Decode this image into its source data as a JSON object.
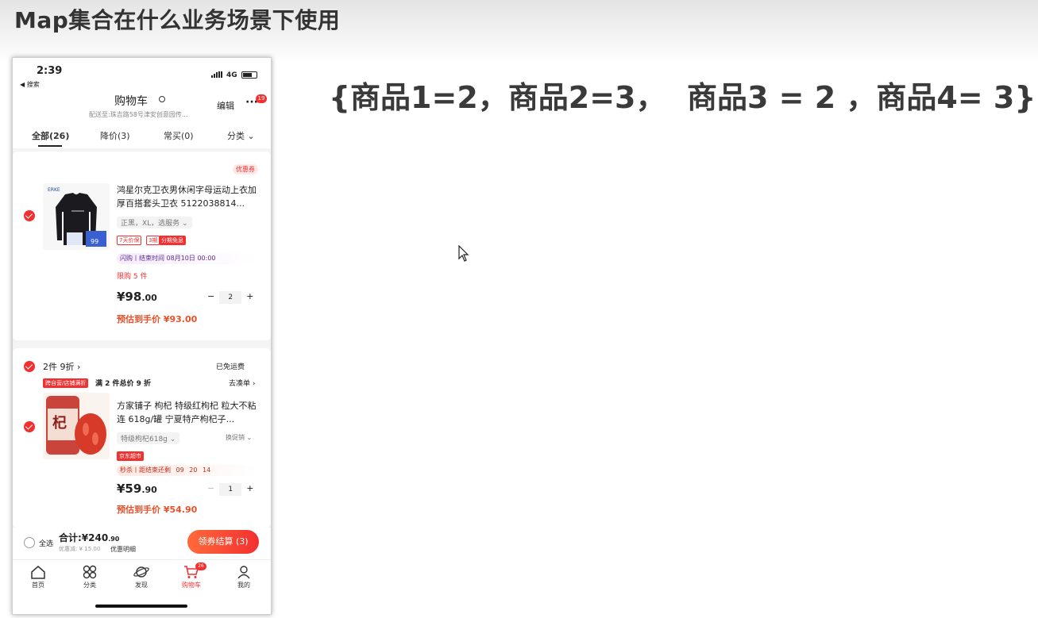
{
  "slide": {
    "title": "Map集合在什么业务场景下使用",
    "formula": "{商品1=2，商品2=3，  商品3 = 2 ，商品4= 3}"
  },
  "phone": {
    "status": {
      "time": "2:39",
      "back": "◀ 搜索",
      "network": "4G"
    },
    "nav": {
      "title": "购物车",
      "address": "配送至:珠吉路58号津安创意园传...",
      "edit": "编辑",
      "more": "···",
      "badge": "19"
    },
    "tabs": [
      "全部(26)",
      "降价(3)",
      "常买(0)",
      "分类 ⌄"
    ],
    "item1": {
      "coupon": "优惠券",
      "title": "鸿星尔克卫衣男休闲字母运动上衣加厚百搭套头卫衣 5122038814...",
      "spec": "正黑，XL，选服务 ⌄",
      "tag_a": "7天价保",
      "tag_b": "3期",
      "tag_c": "分期免息",
      "thumb_price": "99",
      "flash": "闪购丨结束时间 08月10日 00:00",
      "limit": "限购 5 件",
      "price_int": "¥98",
      "price_dec": ".00",
      "qty": "2",
      "est": "预估到手价 ¥93.00"
    },
    "group": {
      "promo": "2件 9折 ›",
      "freight": "已免运费",
      "store_tag": "跨自营/店铺满折",
      "condition": "满 2 件总价 9 折",
      "goto": "去凑单 ›"
    },
    "item2": {
      "title": "方家铺子 枸杞 特级红枸杞 粒大不粘连 618g/罐 宁夏特产枸杞子...",
      "spec": "特级枸杞618g ⌄",
      "switch": "换促销 ⌄",
      "tag": "京东超市",
      "seckill": "秒杀丨距结束还剩",
      "h": "09",
      "m": "20",
      "s": "14",
      "price_int": "¥59",
      "price_dec": ".90",
      "qty": "1",
      "est": "预估到手价 ¥54.90",
      "jar_char": "杞"
    },
    "bottom": {
      "select_all": "全选",
      "total": "合计:¥240",
      "total_dec": ".90",
      "discount": "优惠减: ¥ 15.00",
      "detail": "优惠明细",
      "checkout": "领券结算 (3)"
    },
    "tabbar": [
      "首页",
      "分类",
      "发现",
      "购物车",
      "我的"
    ],
    "tabbar_badge": "26"
  },
  "colors": {
    "accent": "#f23030",
    "estimate": "#e8502a"
  }
}
